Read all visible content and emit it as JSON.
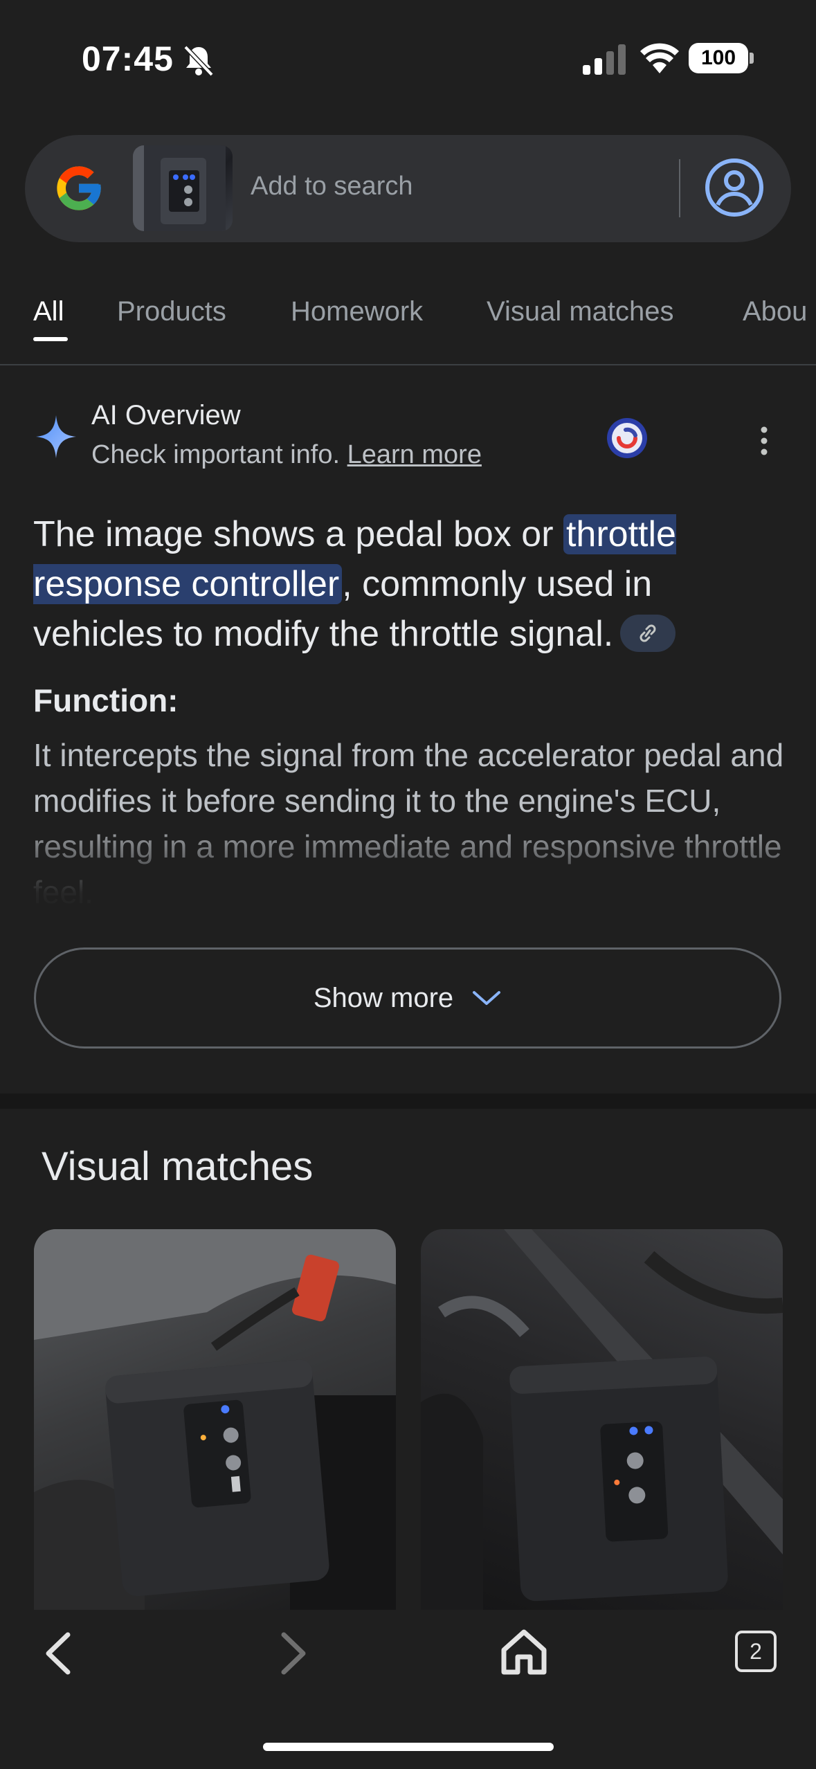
{
  "status_bar": {
    "time": "07:45",
    "battery": "100"
  },
  "search": {
    "placeholder": "Add to search"
  },
  "tabs": [
    {
      "label": "All",
      "active": true
    },
    {
      "label": "Products"
    },
    {
      "label": "Homework"
    },
    {
      "label": "Visual matches"
    },
    {
      "label": "Abou"
    }
  ],
  "ai_overview": {
    "title": "AI Overview",
    "subtitle": "Check important info.",
    "learn_more": "Learn more",
    "summary_before": "The image shows a pedal box or ",
    "summary_highlight": "throttle response controller",
    "summary_after": ", commonly used in vehicles to modify the throttle signal.",
    "function_title": "Function:",
    "function_body": "It intercepts the signal from the accelerator pedal and modifies it before sending it to the engine's ECU, resulting in a more immediate and responsive throttle feel.",
    "show_more": "Show more"
  },
  "visual_matches": {
    "title": "Visual matches"
  },
  "bottom_nav": {
    "tab_count": "2"
  },
  "colors": {
    "background": "#1f1f1f",
    "accent_blue": "#8ab4f8",
    "highlight": "#2a3f6e"
  }
}
